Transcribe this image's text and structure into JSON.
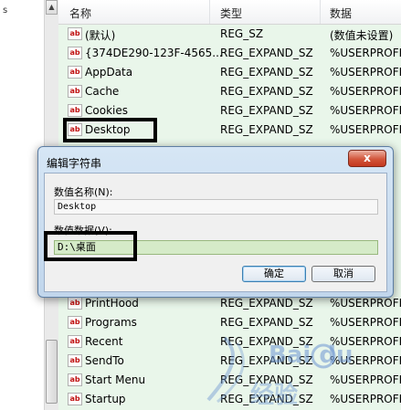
{
  "tree": {
    "expander_glyph": "s"
  },
  "list": {
    "headers": {
      "name": "名称",
      "type": "类型",
      "data": "数据"
    },
    "rows_top": [
      {
        "name": "(默认)",
        "type": "REG_SZ",
        "data": "(数值未设置)"
      },
      {
        "name": "{374DE290-123F-4565...",
        "type": "REG_EXPAND_SZ",
        "data": "%USERPROFI"
      },
      {
        "name": "AppData",
        "type": "REG_EXPAND_SZ",
        "data": "%USERPROFI"
      },
      {
        "name": "Cache",
        "type": "REG_EXPAND_SZ",
        "data": "%USERPROFI"
      },
      {
        "name": "Cookies",
        "type": "REG_EXPAND_SZ",
        "data": "%USERPROFI"
      },
      {
        "name": "Desktop",
        "type": "REG_EXPAND_SZ",
        "data": "%USERPROFI"
      }
    ],
    "rows_bottom": [
      {
        "name": "PrintHood",
        "type": "REG_EXPAND_SZ",
        "data": "%USERPROFI"
      },
      {
        "name": "Programs",
        "type": "REG_EXPAND_SZ",
        "data": "%USERPROFI"
      },
      {
        "name": "Recent",
        "type": "REG_EXPAND_SZ",
        "data": "%USERPROFI"
      },
      {
        "name": "SendTo",
        "type": "REG_EXPAND_SZ",
        "data": "%USERPROFI"
      },
      {
        "name": "Start Menu",
        "type": "REG_EXPAND_SZ",
        "data": "%USERPROFI"
      },
      {
        "name": "Startup",
        "type": "REG_EXPAND_SZ",
        "data": "%USERPROFI"
      }
    ],
    "value_icon_text": "ab"
  },
  "dialog": {
    "title": "编辑字符串",
    "close_symbol": "x",
    "name_label": "数值名称(N):",
    "name_value": "Desktop",
    "data_label": "数值数据(V):",
    "data_value": "D:\\桌面",
    "ok_label": "确定",
    "cancel_label": "取消"
  },
  "watermark": {
    "brand": "Bai du",
    "sub": "经验"
  },
  "colors": {
    "list_background": "#e9f6ea",
    "highlight_box": "#000000",
    "close_button": "#c7432a",
    "data_field": "#d5ebc8"
  }
}
